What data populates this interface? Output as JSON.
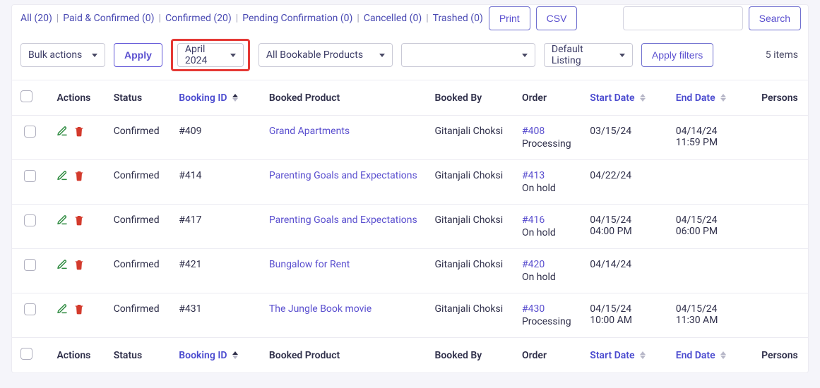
{
  "filters": {
    "all_label": "All",
    "all_count": 20,
    "paid_confirmed_label": "Paid & Confirmed",
    "paid_confirmed_count": 0,
    "confirmed_label": "Confirmed",
    "confirmed_count": 20,
    "pending_label": "Pending Confirmation",
    "pending_count": 0,
    "cancelled_label": "Cancelled",
    "cancelled_count": 0,
    "trashed_label": "Trashed",
    "trashed_count": 0
  },
  "buttons": {
    "print": "Print",
    "csv": "CSV",
    "search": "Search",
    "apply": "Apply",
    "apply_filters": "Apply filters"
  },
  "selects": {
    "bulk": "Bulk actions",
    "month": "April 2024",
    "product": "All Bookable Products",
    "empty_select": "",
    "listing": "Default Listing"
  },
  "summary": {
    "items_text": "5 items"
  },
  "columns": {
    "check": "",
    "actions": "Actions",
    "status": "Status",
    "booking_id": "Booking ID",
    "booked_product": "Booked Product",
    "booked_by": "Booked By",
    "order": "Order",
    "start_date": "Start Date",
    "end_date": "End Date",
    "persons": "Persons"
  },
  "rows": [
    {
      "status": "Confirmed",
      "booking_id": "#409",
      "product": "Grand Apartments",
      "booked_by": "Gitanjali Choksi",
      "order_id": "#408",
      "order_status": "Processing",
      "start_date": "03/15/24",
      "start_time": "",
      "end_date": "04/14/24",
      "end_time": "11:59 PM"
    },
    {
      "status": "Confirmed",
      "booking_id": "#414",
      "product": "Parenting Goals and Expectations",
      "booked_by": "Gitanjali Choksi",
      "order_id": "#413",
      "order_status": "On hold",
      "start_date": "04/22/24",
      "start_time": "",
      "end_date": "",
      "end_time": ""
    },
    {
      "status": "Confirmed",
      "booking_id": "#417",
      "product": "Parenting Goals and Expectations",
      "booked_by": "Gitanjali Choksi",
      "order_id": "#416",
      "order_status": "On hold",
      "start_date": "04/15/24",
      "start_time": "04:00 PM",
      "end_date": "04/15/24",
      "end_time": "06:00 PM"
    },
    {
      "status": "Confirmed",
      "booking_id": "#421",
      "product": "Bungalow for Rent",
      "booked_by": "Gitanjali Choksi",
      "order_id": "#420",
      "order_status": "On hold",
      "start_date": "04/14/24",
      "start_time": "",
      "end_date": "",
      "end_time": ""
    },
    {
      "status": "Confirmed",
      "booking_id": "#431",
      "product": "The Jungle Book movie",
      "booked_by": "Gitanjali Choksi",
      "order_id": "#430",
      "order_status": "Processing",
      "start_date": "04/15/24",
      "start_time": "10:00 AM",
      "end_date": "04/15/24",
      "end_time": "11:30 AM"
    }
  ]
}
